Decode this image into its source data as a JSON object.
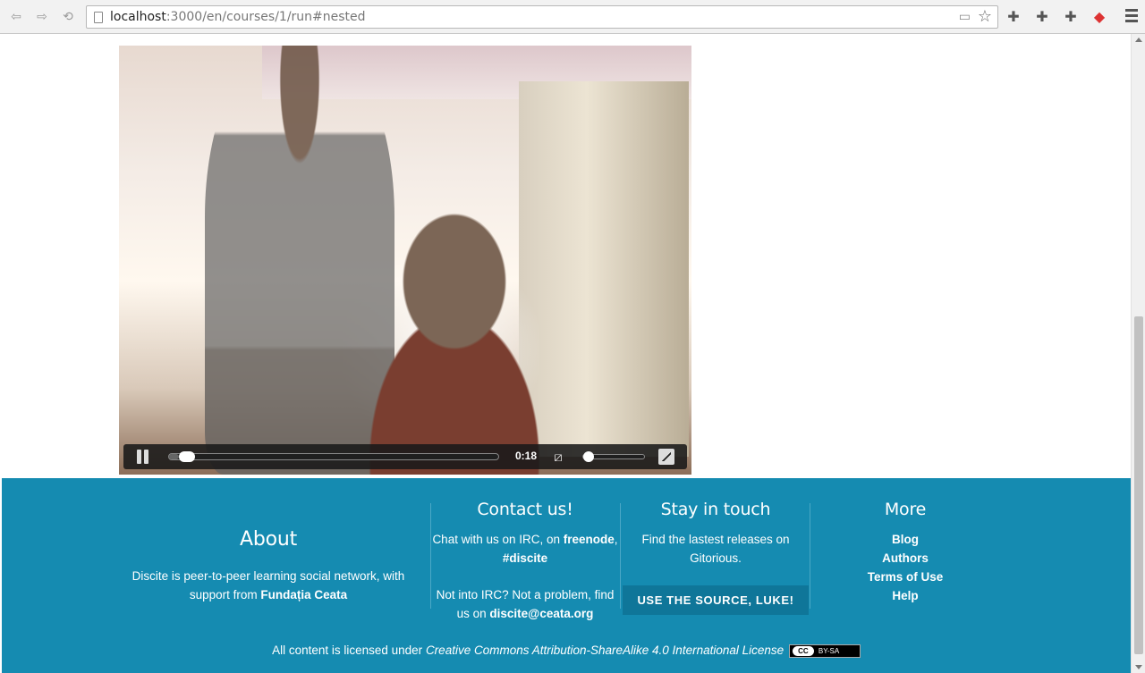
{
  "browser": {
    "url_host": "localhost",
    "url_rest": ":3000/en/courses/1/run#nested",
    "back_icon": "back-arrow-icon",
    "forward_icon": "forward-arrow-icon",
    "reload_icon": "reload-icon"
  },
  "video": {
    "time": "0:18",
    "progress_fraction": 0.03,
    "volume_fraction": 0.0
  },
  "footer": {
    "about": {
      "title": "About",
      "text_pre": "Discite is peer-to-peer learning social network, with support from ",
      "link": "Fundația Ceata"
    },
    "contact": {
      "title": "Contact us!",
      "irc_pre": "Chat with us on IRC, on ",
      "irc_network": "freenode",
      "irc_sep": ", ",
      "irc_channel": "#discite",
      "mail_pre": "Not into IRC? Not a problem, find us on ",
      "mail": "discite@ceata.org"
    },
    "stay": {
      "title": "Stay in touch",
      "text": "Find the lastest releases on Gitorious.",
      "button": "USE THE SOURCE, LUKE!"
    },
    "more": {
      "title": "More",
      "links": [
        "Blog",
        "Authors",
        "Terms of Use",
        "Help"
      ]
    },
    "license": {
      "pre": "All content is licensed under ",
      "name": "Creative Commons Attribution-ShareAlike 4.0 International License",
      "badge_cc": "CC",
      "badge_by": "BY-SA"
    }
  },
  "colors": {
    "footer_bg": "#158bb1",
    "button_bg": "#0f7699"
  }
}
